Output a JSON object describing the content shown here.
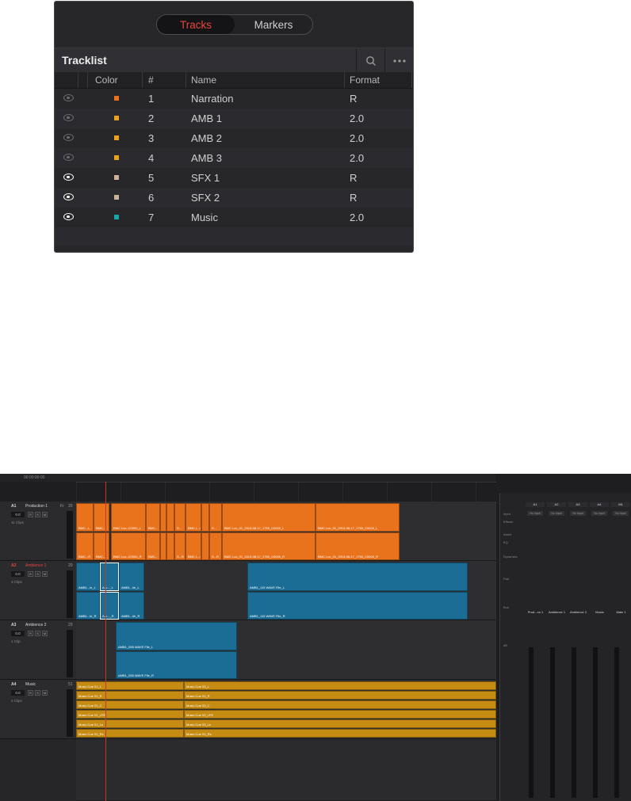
{
  "tracklist": {
    "tabs": [
      {
        "label": "Tracks",
        "active": true
      },
      {
        "label": "Markers",
        "active": false
      }
    ],
    "title": "Tracklist",
    "columns": {
      "color": "Color",
      "number": "#",
      "name": "Name",
      "format": "Format"
    },
    "rows": [
      {
        "visible": false,
        "color": "#e8731c",
        "number": "1",
        "name": "Narration",
        "format": "R"
      },
      {
        "visible": false,
        "color": "#e8a21c",
        "number": "2",
        "name": "AMB 1",
        "format": "2.0"
      },
      {
        "visible": false,
        "color": "#e8a21c",
        "number": "3",
        "name": "AMB 2",
        "format": "2.0"
      },
      {
        "visible": false,
        "color": "#e8a21c",
        "number": "4",
        "name": "AMB 3",
        "format": "2.0"
      },
      {
        "visible": true,
        "color": "#c9b49b",
        "number": "5",
        "name": "SFX 1",
        "format": "R"
      },
      {
        "visible": true,
        "color": "#c9b49b",
        "number": "6",
        "name": "SFX 2",
        "format": "R"
      },
      {
        "visible": true,
        "color": "#1ba6a6",
        "number": "7",
        "name": "Music",
        "format": "2.0"
      }
    ],
    "icons": [
      "search-icon",
      "more-icon",
      "eye-icon"
    ]
  },
  "timeline": {
    "timecode": "00:00:00:00",
    "tracks": [
      {
        "id": "A1",
        "name": "Production 1",
        "format": "Fr",
        "level": "20",
        "clips_label": "11 Clips",
        "volume": "0.0"
      },
      {
        "id": "A2",
        "name": "Ambience 1",
        "format": "",
        "level": "20",
        "clips_label": "3 Clips",
        "volume": "0.0"
      },
      {
        "id": "A3",
        "name": "Ambience 2",
        "format": "",
        "level": "20",
        "clips_label": "1 Clip",
        "volume": "0.0"
      },
      {
        "id": "A4",
        "name": "Music",
        "format": "",
        "level": "51",
        "clips_label": "2 Clips",
        "volume": "0.0"
      }
    ],
    "track_buttons": [
      "R",
      "S",
      "M"
    ],
    "clips": {
      "a1_top": [
        "BMC...L",
        "BMC...",
        "BMC Loc..C0000_L",
        "BMC...",
        "S...",
        "BMC L...000_L",
        "S...",
        "BMC Loc_01_2013-08-17_1750_C0000_L",
        "BMC Loc_01_2013-08-17_1750_C0000_L"
      ],
      "a1_bottom": [
        "BMC...R",
        "BMC...",
        "BMC Loc..C0000_R",
        "BMC...",
        "S...R",
        "BMC L...000_R",
        "S...R",
        "BMC Loc_01_2013-08-17_1750_C0000_R",
        "BMC Loc_01_2013-08-17_1750_C0000_R"
      ],
      "a2_top": [
        "AMB1...le_L",
        "A A..._L",
        "AMB1...ile_L",
        "AMB1_115 WAVE File_L"
      ],
      "a2_bottom": [
        "AMB1...le_R",
        "A A..._R",
        "AMB1...ile_R",
        "AMB1_115 WAVE File_R"
      ],
      "a3": [
        "AMB1_055 WAVE File_L",
        "AMB1_055 WAVE File_R"
      ],
      "a4_left": [
        "Music Cue 01_L",
        "Music Cue 01_R",
        "Music Cue 01_C",
        "Music Cue 01_LFE",
        "Music Cue 01_Ls",
        "Music Cue 01_Rs"
      ],
      "a4_right": [
        "Music Cue 03_L",
        "Music Cue 03_R",
        "Music Cue 03_C",
        "Music Cue 03_LFE",
        "Music Cue 03_Ls",
        "Music Cue 03_Rs"
      ]
    },
    "mixer": {
      "channels": [
        "A1",
        "A2",
        "A3",
        "A4",
        "M1"
      ],
      "row_labels": [
        "Input",
        "Effects",
        "Insert",
        "EQ",
        "Dynamics",
        "Pan",
        "Bus",
        "dB"
      ],
      "input_values": [
        "No Input",
        "No Input",
        "No Input",
        "No Input",
        "No Input"
      ],
      "names": [
        "Prod...on 1",
        "Ambience 1",
        "Ambience 2",
        "Music",
        "Main 1"
      ]
    },
    "colors": {
      "production": "#e8731c",
      "ambience": "#1b6d96",
      "music": "#c58b12",
      "playhead": "#c0392b"
    }
  }
}
